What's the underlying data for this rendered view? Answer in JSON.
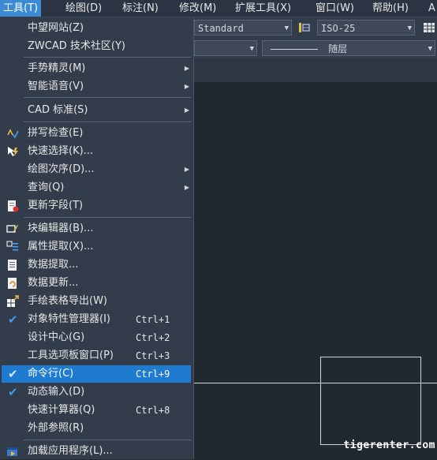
{
  "menubar": {
    "items": [
      "工具(T)",
      "绘图(D)",
      "标注(N)",
      "修改(M)",
      "扩展工具(X)",
      "窗口(W)",
      "帮助(H)",
      "A"
    ]
  },
  "toolbar": {
    "dimstyle": "Standard",
    "iso": "ISO-25",
    "linetype": "随层"
  },
  "watermark": "tigerenter.com",
  "menu": {
    "items": [
      {
        "label": "中望网站(Z)"
      },
      {
        "label": "ZWCAD 技术社区(Y)"
      },
      {
        "label": "手势精灵(M)"
      },
      {
        "label": "智能语音(V)"
      },
      {
        "label": "CAD 标准(S)"
      },
      {
        "label": "拼写检查(E)"
      },
      {
        "label": "快速选择(K)..."
      },
      {
        "label": "绘图次序(D)..."
      },
      {
        "label": "查询(Q)"
      },
      {
        "label": "更新字段(T)"
      },
      {
        "label": "块编辑器(B)..."
      },
      {
        "label": "属性提取(X)..."
      },
      {
        "label": "数据提取..."
      },
      {
        "label": "数据更新..."
      },
      {
        "label": "手绘表格导出(W)"
      },
      {
        "label": "对象特性管理器(I)",
        "shortcut": "Ctrl+1"
      },
      {
        "label": "设计中心(G)",
        "shortcut": "Ctrl+2"
      },
      {
        "label": "工具选项板窗口(P)",
        "shortcut": "Ctrl+3"
      },
      {
        "label": "命令行(C)",
        "shortcut": "Ctrl+9"
      },
      {
        "label": "动态输入(D)"
      },
      {
        "label": "快速计算器(Q)",
        "shortcut": "Ctrl+8"
      },
      {
        "label": "外部参照(R)"
      },
      {
        "label": "加载应用程序(L)..."
      }
    ]
  }
}
